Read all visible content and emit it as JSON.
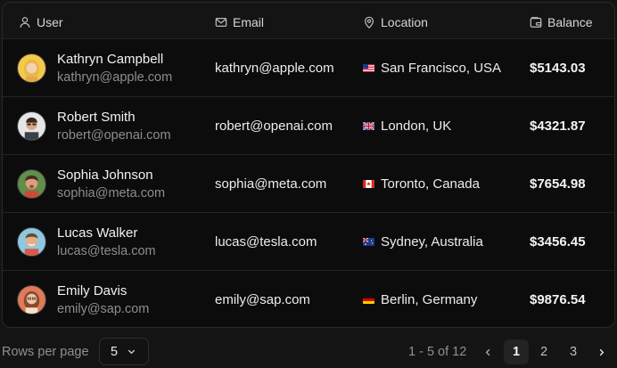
{
  "headers": {
    "user": "User",
    "email": "Email",
    "location": "Location",
    "balance": "Balance"
  },
  "rows": [
    {
      "name": "Kathryn Campbell",
      "sub_email": "kathryn@apple.com",
      "email": "kathryn@apple.com",
      "location": "San Francisco, USA",
      "flag": "us-flag",
      "balance": "$5143.03"
    },
    {
      "name": "Robert Smith",
      "sub_email": "robert@openai.com",
      "email": "robert@openai.com",
      "location": "London, UK",
      "flag": "uk-flag",
      "balance": "$4321.87"
    },
    {
      "name": "Sophia Johnson",
      "sub_email": "sophia@meta.com",
      "email": "sophia@meta.com",
      "location": "Toronto, Canada",
      "flag": "canada-flag",
      "balance": "$7654.98"
    },
    {
      "name": "Lucas Walker",
      "sub_email": "lucas@tesla.com",
      "email": "lucas@tesla.com",
      "location": "Sydney, Australia",
      "flag": "australia-flag",
      "balance": "$3456.45"
    },
    {
      "name": "Emily Davis",
      "sub_email": "emily@sap.com",
      "email": "emily@sap.com",
      "location": "Berlin, Germany",
      "flag": "germany-flag",
      "balance": "$9876.54"
    }
  ],
  "footer": {
    "rows_per_page_label": "Rows per page",
    "rows_per_page_value": "5",
    "range_text": "1 - 5 of 12",
    "pages": [
      "1",
      "2",
      "3"
    ],
    "current_page": "1"
  },
  "icons": {
    "user": "user-icon",
    "email": "mail-icon",
    "location": "map-pin-icon",
    "balance": "wallet-icon",
    "select": "chevron-down-icon",
    "prev": "chevron-left-icon",
    "next": "chevron-right-icon"
  },
  "colors": {
    "background": "#0c0c0d",
    "active_page_bg": "#232325",
    "muted_text": "#8d8d92"
  }
}
